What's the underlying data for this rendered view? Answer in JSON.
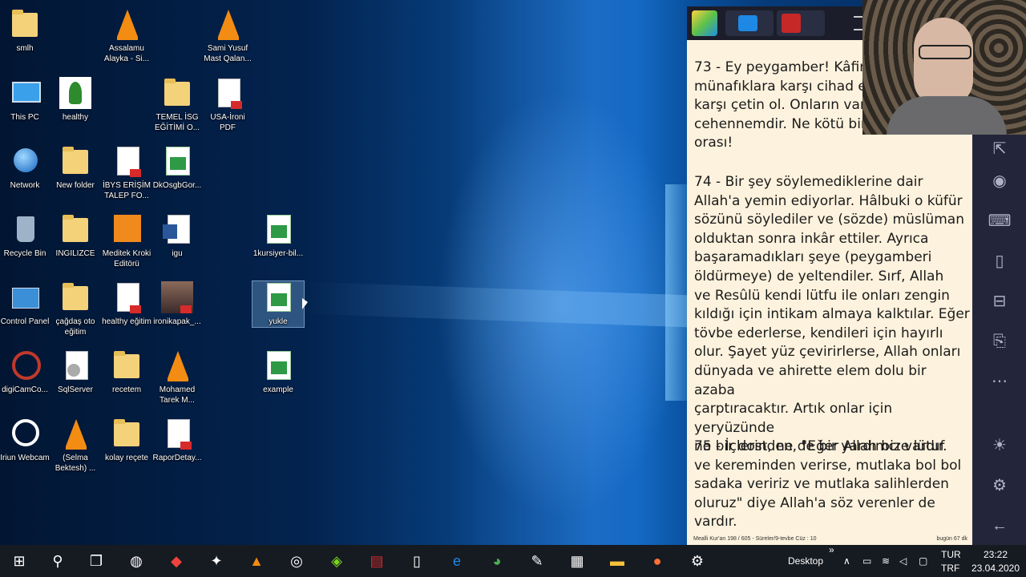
{
  "desktop_icons": [
    {
      "label": "smlh"
    },
    {
      "label": "Assalamu Alayka - Si..."
    },
    {
      "label": "Sami Yusuf Mast Qalan..."
    },
    {
      "label": "This PC"
    },
    {
      "label": "healthy"
    },
    {
      "label": "TEMEL İSG EĞİTİMİ O..."
    },
    {
      "label": "USA-İroni PDF"
    },
    {
      "label": "Network"
    },
    {
      "label": "New folder"
    },
    {
      "label": "İBYS ERİŞİM TALEP FO..."
    },
    {
      "label": "DkOsgbGor..."
    },
    {
      "label": "Recycle Bin"
    },
    {
      "label": "INGILIZCE"
    },
    {
      "label": "Meditek Kroki Editörü"
    },
    {
      "label": "igu"
    },
    {
      "label": "1kursiyer-bil..."
    },
    {
      "label": "Control Panel"
    },
    {
      "label": "çağdaş oto eğitim"
    },
    {
      "label": "healthy eğitim"
    },
    {
      "label": "ironikapak_..."
    },
    {
      "label": "yukle"
    },
    {
      "label": "digiCamCo..."
    },
    {
      "label": "SqlServer"
    },
    {
      "label": "recetem"
    },
    {
      "label": "Mohamed Tarek  M..."
    },
    {
      "label": "example"
    },
    {
      "label": "Iriun Webcam"
    },
    {
      "label": "(Selma Bektesh) ..."
    },
    {
      "label": "kolay reçete"
    },
    {
      "label": "RaporDetay..."
    }
  ],
  "reader": {
    "verse73": "73 - Ey peygamber! Kâfirle\nmünafıklara karşı cihad et\nkarşı çetin ol. Onların vara\ncehennemdir. Ne kötü bir\norası!",
    "verse74": "74 - Bir şey söylemediklerine dair\nAllah'a yemin ediyorlar. Hâlbuki o küfür\nsözünü söylediler ve (sözde) müslüman\nolduktan sonra inkâr ettiler. Ayrıca\nbaşaramadıkları şeye (peygamberi\nöldürmeye) de yeltendiler. Sırf, Allah\nve Resûlü kendi lütfu ile onları zengin\nkıldığı için intikam almaya kalktılar. Eğer\ntövbe ederlerse, kendileri için hayırlı\nolur. Şayet yüz çevirirlerse, Allah onları\ndünyada ve ahirette elem dolu bir azaba\nçarptıracaktır. Artık onlar için yeryüzünde\nne bir dost, ne de bir yardımcı vardır.",
    "verse75": "75 - İçlerinden, \"Eğer Allah bize lütuf\nve kereminden verirse, mutlaka bol bol\nsadaka veririz ve mutlaka salihlerden\noluruz\" diye Allah'a söz verenler de\nvardır.",
    "footer_left": "Mealli Kur'an 198 / 605 - Süreler/9-tevbe Cüz : 10",
    "footer_right": "bugün 67 dk"
  },
  "taskbar": {
    "desktop_label": "Desktop",
    "lang_line1": "TUR",
    "lang_line2": "TRF",
    "time": "23:22",
    "date": "23.04.2020"
  },
  "colors": {
    "taskbar": "#161a21",
    "reader_bg": "#fdf2dd",
    "sidebar": "#23263a"
  }
}
